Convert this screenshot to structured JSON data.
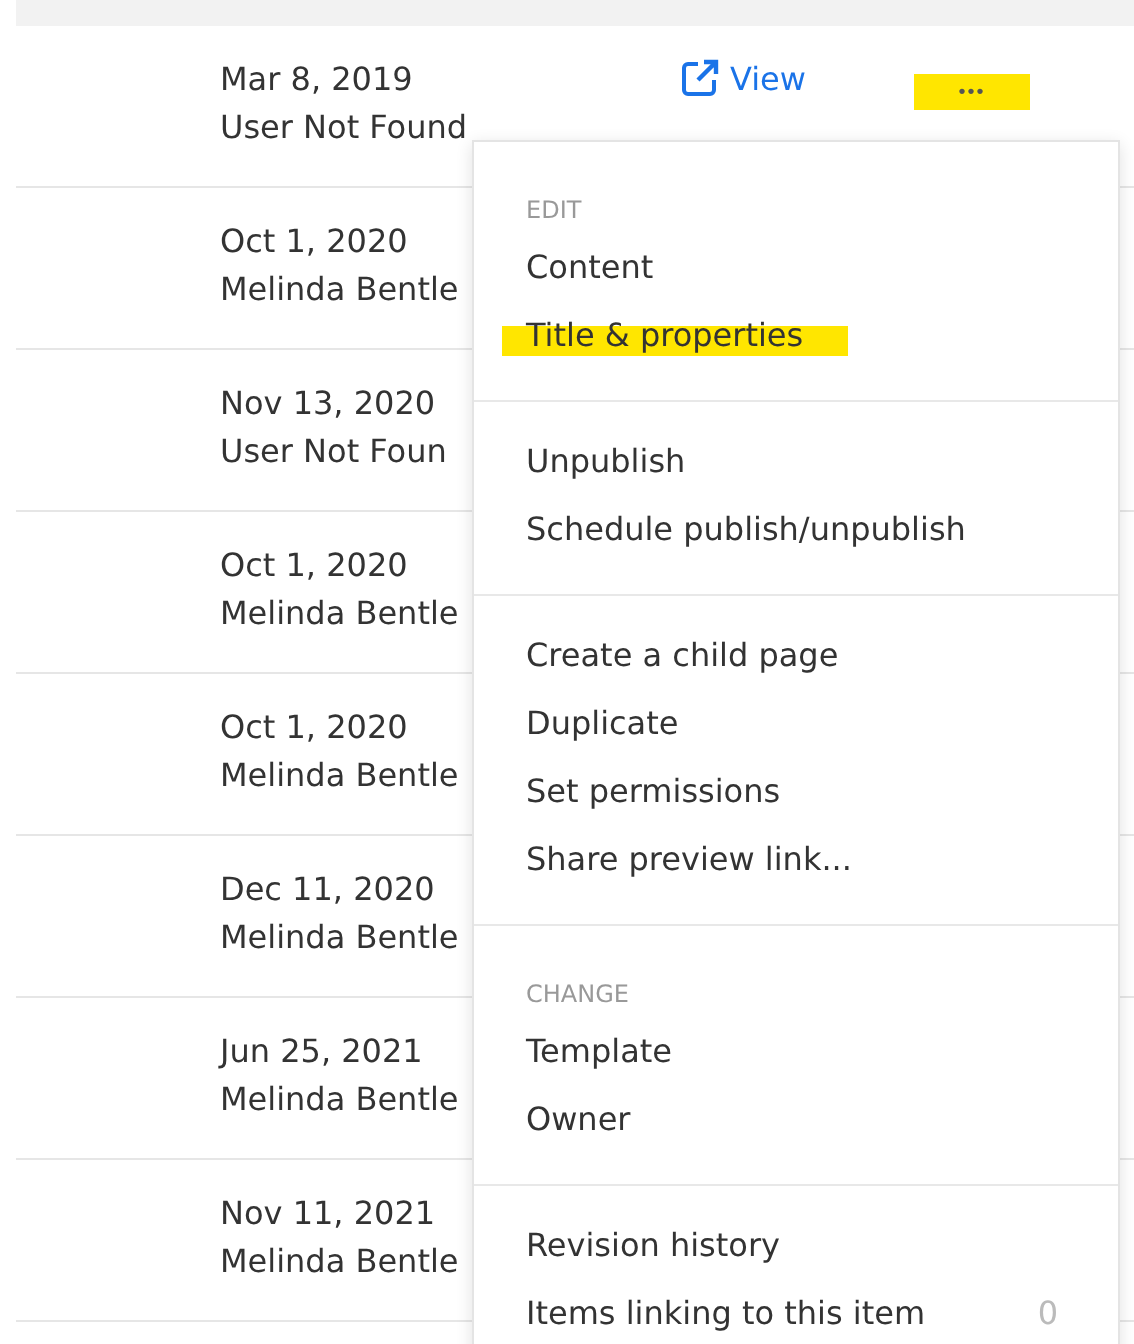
{
  "rows": [
    {
      "date": "Mar 8, 2019",
      "author": "User Not Found",
      "view_link": {
        "label": "View"
      },
      "more": {
        "label": "•••",
        "highlighted": true
      }
    },
    {
      "date": "Oct 1, 2020",
      "author": "Melinda Bentle"
    },
    {
      "date": "Nov 13, 2020",
      "author": "User Not Foun"
    },
    {
      "date": "Oct 1, 2020",
      "author": "Melinda Bentle"
    },
    {
      "date": "Oct 1, 2020",
      "author": "Melinda Bentle"
    },
    {
      "date": "Dec 11, 2020",
      "author": "Melinda Bentle"
    },
    {
      "date": "Jun 25, 2021",
      "author": "Melinda Bentle"
    },
    {
      "date": "Nov 11, 2021",
      "author": "Melinda Bentle"
    }
  ],
  "context_menu": {
    "sections": [
      {
        "header": "EDIT",
        "items": [
          {
            "label": "Content",
            "highlighted": false
          },
          {
            "label": "Title & properties",
            "highlighted": true
          }
        ]
      },
      {
        "items": [
          {
            "label": "Unpublish",
            "highlighted": false
          },
          {
            "label": "Schedule publish/unpublish",
            "highlighted": false
          }
        ]
      },
      {
        "items": [
          {
            "label": "Create a child page",
            "highlighted": false
          },
          {
            "label": "Duplicate",
            "highlighted": false
          },
          {
            "label": "Set permissions",
            "highlighted": false
          },
          {
            "label": "Share preview link...",
            "highlighted": false
          }
        ]
      },
      {
        "header": "CHANGE",
        "items": [
          {
            "label": "Template",
            "highlighted": false
          },
          {
            "label": "Owner",
            "highlighted": false
          }
        ]
      },
      {
        "items": [
          {
            "label": "Revision history",
            "highlighted": false
          },
          {
            "label": "Items linking to this item",
            "count": "0",
            "highlighted": false
          }
        ]
      }
    ]
  }
}
